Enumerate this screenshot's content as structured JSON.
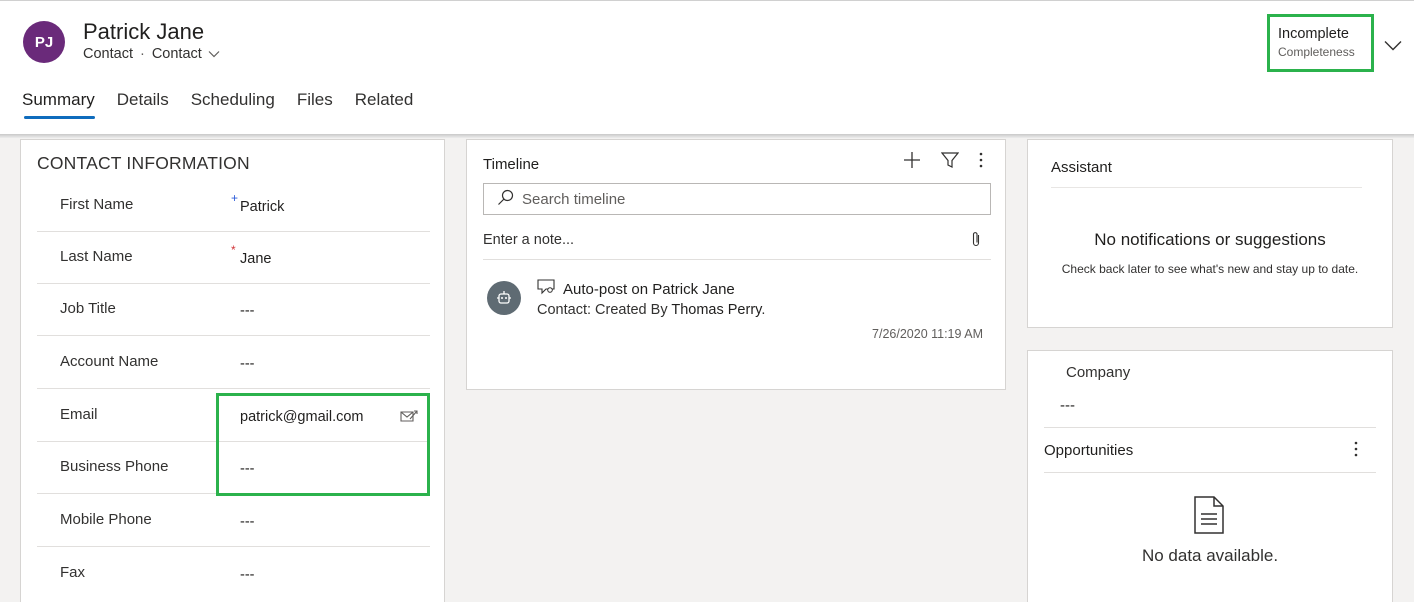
{
  "header": {
    "avatar_initials": "PJ",
    "avatar_color": "#6a2a7a",
    "title": "Patrick Jane",
    "entity": "Contact",
    "separator": "·",
    "form_selector": "Contact",
    "completeness_value": "Incomplete",
    "completeness_label": "Completeness"
  },
  "tabs": [
    {
      "label": "Summary",
      "active": true
    },
    {
      "label": "Details",
      "active": false
    },
    {
      "label": "Scheduling",
      "active": false
    },
    {
      "label": "Files",
      "active": false
    },
    {
      "label": "Related",
      "active": false
    }
  ],
  "contact_info": {
    "section_title": "CONTACT INFORMATION",
    "fields": [
      {
        "label": "First Name",
        "value": "Patrick",
        "required_marker": "+",
        "required_color": "#2b5bd9"
      },
      {
        "label": "Last Name",
        "value": "Jane",
        "required_marker": "*",
        "required_color": "#d13438"
      },
      {
        "label": "Job Title",
        "value": "---"
      },
      {
        "label": "Account Name",
        "value": "---"
      },
      {
        "label": "Email",
        "value": "patrick@gmail.com"
      },
      {
        "label": "Business Phone",
        "value": "---"
      },
      {
        "label": "Mobile Phone",
        "value": "---"
      },
      {
        "label": "Fax",
        "value": "---"
      }
    ]
  },
  "timeline": {
    "title": "Timeline",
    "search_placeholder": "Search timeline",
    "note_placeholder": "Enter a note...",
    "post": {
      "title": "Auto-post on Patrick Jane",
      "body_prefix": "Contact: Created By ",
      "body_author": "Thomas Perry",
      "body_suffix": ".",
      "timestamp": "7/26/2020 11:19 AM"
    }
  },
  "assistant": {
    "title": "Assistant",
    "empty_title": "No notifications or suggestions",
    "empty_sub": "Check back later to see what's new and stay up to date."
  },
  "company_panel": {
    "company_label": "Company",
    "company_value": "---",
    "opportunities_title": "Opportunities",
    "empty_text": "No data available."
  },
  "colors": {
    "highlight": "#2bb24c",
    "tab_underline": "#0f6cbd"
  }
}
